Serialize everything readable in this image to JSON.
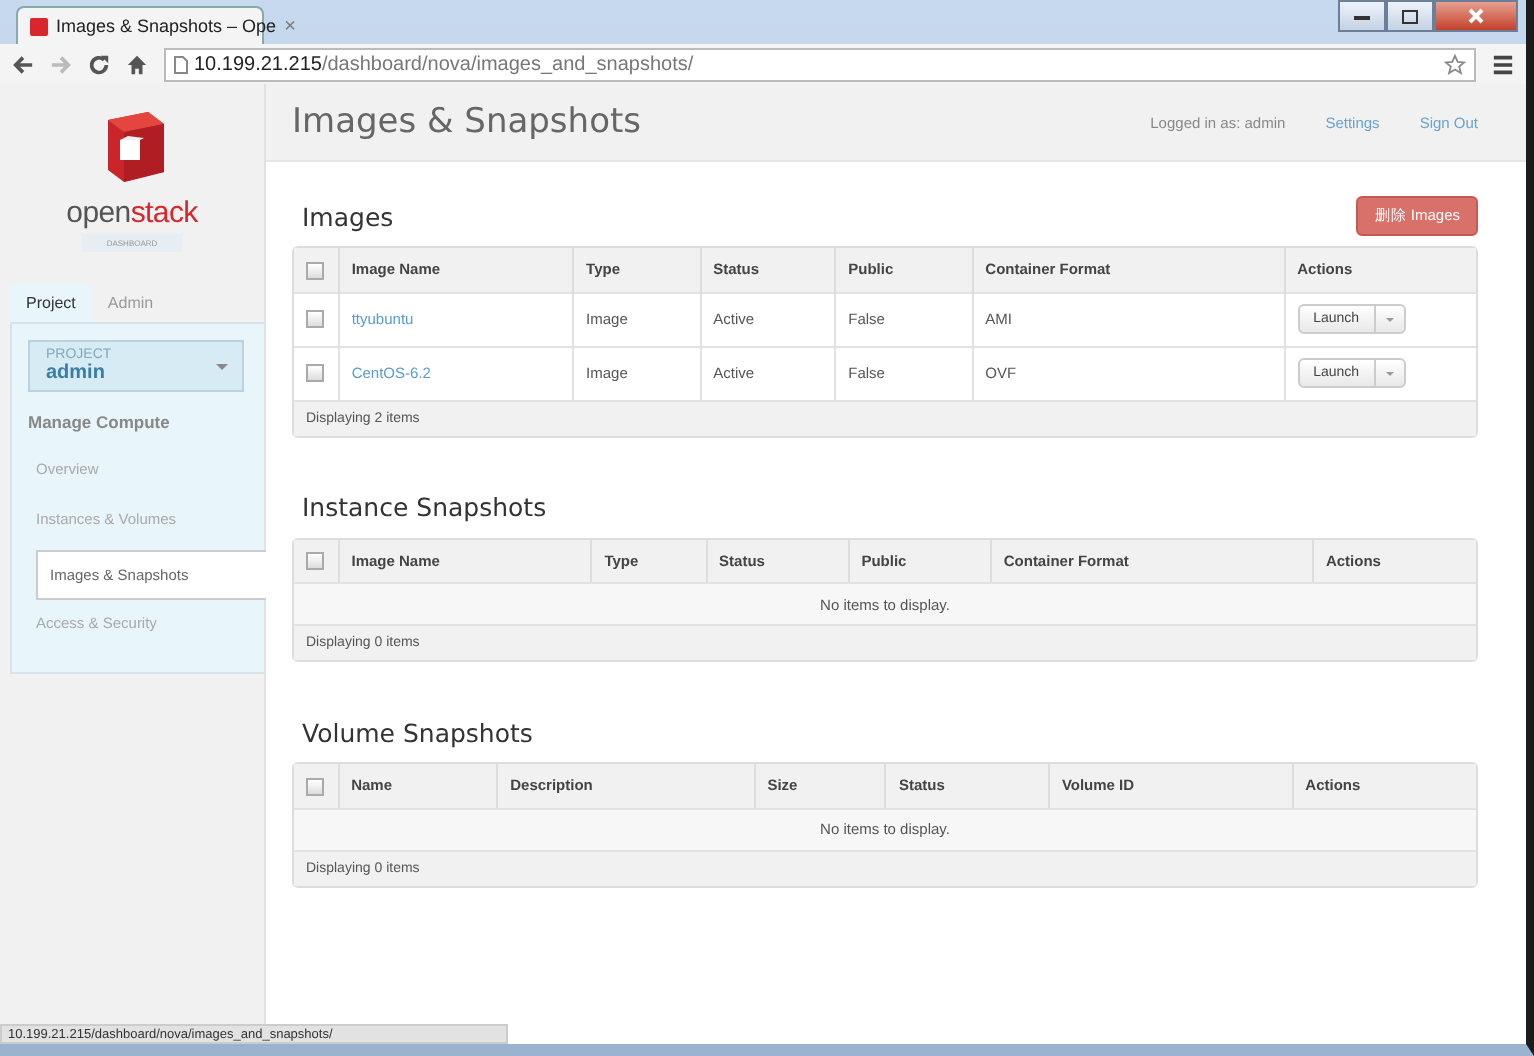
{
  "browser": {
    "tab_title": "Images & Snapshots – Ope",
    "tab_close": "×",
    "url_host": "10.199.21.215",
    "url_path": "/dashboard/nova/images_and_snapshots/",
    "status_url": "10.199.21.215/dashboard/nova/images_and_snapshots/"
  },
  "sidebar": {
    "wordmark": [
      "open",
      "stack"
    ],
    "tagline": "DASHBOARD",
    "tabs": [
      {
        "label": "Project",
        "selected": true
      },
      {
        "label": "Admin",
        "selected": false
      }
    ],
    "project": {
      "label": "PROJECT",
      "value": "admin"
    },
    "heading": "Manage Compute",
    "items": [
      {
        "label": "Overview",
        "selected": false
      },
      {
        "label": "Instances & Volumes",
        "selected": false
      },
      {
        "label": "Images & Snapshots",
        "selected": true
      },
      {
        "label": "Access & Security",
        "selected": false
      }
    ]
  },
  "header": {
    "title": "Images & Snapshots",
    "user": "Logged in as: admin",
    "links": [
      "Settings",
      "Sign Out"
    ]
  },
  "sections": [
    {
      "title": "Images",
      "action": "删除 Images",
      "all_checked": false,
      "columns": [
        "Image Name",
        "Type",
        "Status",
        "Public",
        "Container Format",
        "Actions"
      ],
      "rows": [
        {
          "cells": [
            "ttyubuntu",
            "Image",
            "Active",
            "False",
            "AMI"
          ],
          "action": "Launch",
          "checked": false
        },
        {
          "cells": [
            "CentOS-6.2",
            "Image",
            "Active",
            "False",
            "OVF"
          ],
          "action": "Launch",
          "checked": false
        }
      ],
      "footer": "Displaying 2 items"
    },
    {
      "title": "Instance Snapshots",
      "all_checked": false,
      "columns": [
        "Image Name",
        "Type",
        "Status",
        "Public",
        "Container Format",
        "Actions"
      ],
      "empty": "No items to display.",
      "footer": "Displaying 0 items"
    },
    {
      "title": "Volume Snapshots",
      "all_checked": false,
      "columns": [
        "Name",
        "Description",
        "Size",
        "Status",
        "Volume ID",
        "Actions"
      ],
      "empty": "No items to display.",
      "footer": "Displaying 0 items"
    }
  ]
}
